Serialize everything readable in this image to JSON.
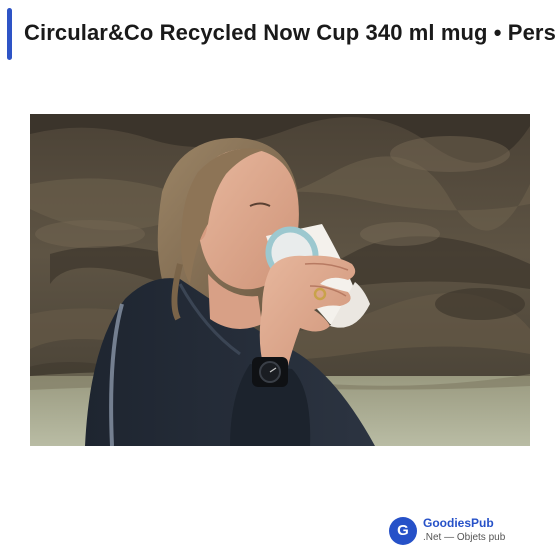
{
  "header": {
    "title": "Circular&Co Recycled Now Cup 340 ml mug • Pers",
    "accent_color": "#2e54c6"
  },
  "main_image": {
    "icon": "photo-woman-drinking-from-cup"
  },
  "footer_brand": {
    "logo_letter": "G",
    "name": "GoodiesPub",
    "tagline": ".Net — Objets pub",
    "brand_color": "#2651c8"
  }
}
